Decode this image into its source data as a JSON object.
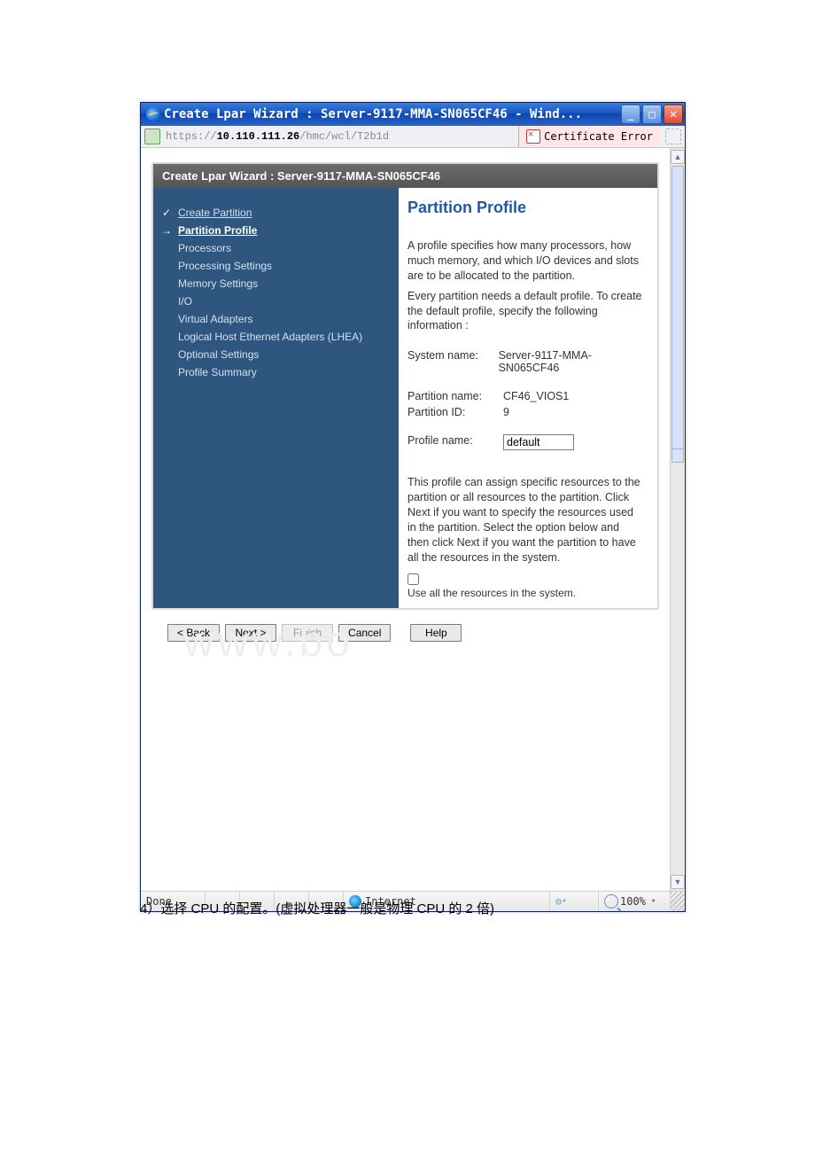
{
  "window": {
    "title": "Create Lpar Wizard : Server-9117-MMA-SN065CF46 - Wind...",
    "url_prefix": "https://",
    "url_host": "10.110.111.26",
    "url_path": "/hmc/wcl/T2b1d",
    "cert_error": "Certificate Error"
  },
  "inner_header": "Create Lpar Wizard : Server-9117-MMA-SN065CF46",
  "sidebar": {
    "steps": [
      {
        "label": "Create Partition",
        "mark": "✓",
        "link": true
      },
      {
        "label": "Partition Profile",
        "mark": "→",
        "link": true,
        "current": true
      },
      {
        "label": "Processors",
        "indent": true
      },
      {
        "label": "Processing Settings",
        "indent": true
      },
      {
        "label": "Memory Settings",
        "indent": true
      },
      {
        "label": "I/O",
        "indent": true
      },
      {
        "label": "Virtual Adapters",
        "indent": true
      },
      {
        "label": "Logical Host Ethernet Adapters (LHEA)",
        "indent": true
      },
      {
        "label": "Optional Settings",
        "indent": true
      },
      {
        "label": "Profile Summary",
        "indent": true
      }
    ]
  },
  "main": {
    "heading": "Partition Profile",
    "para1": "A profile specifies how many processors, how much memory, and which I/O devices and slots are to be allocated to the partition.",
    "para2": "Every partition needs a default profile. To create the default profile, specify the following information :",
    "system_name_label": "System name:",
    "system_name_value": "Server-9117-MMA-SN065CF46",
    "partition_name_label": "Partition name:",
    "partition_name_value": "CF46_VIOS1",
    "partition_id_label": "Partition ID:",
    "partition_id_value": "9",
    "profile_name_label": "Profile name:",
    "profile_name_value": "default",
    "para3": "This profile can assign specific resources to the partition or all resources to the partition. Click Next if you want to specify the resources used in the partition. Select the option below and then click Next if you want the partition to have all the resources in the system.",
    "checkbox_label": "Use all the resources in the system."
  },
  "buttons": {
    "back": "< Back",
    "next": "Next >",
    "finish": "Finish",
    "cancel": "Cancel",
    "help": "Help"
  },
  "status": {
    "done": "Done",
    "zone": "Internet",
    "zoom": "100%"
  },
  "caption": "4）选择 CPU 的配置。(虚拟处理器一般是物理 CPU 的 2 倍)",
  "watermark": "www.bo"
}
